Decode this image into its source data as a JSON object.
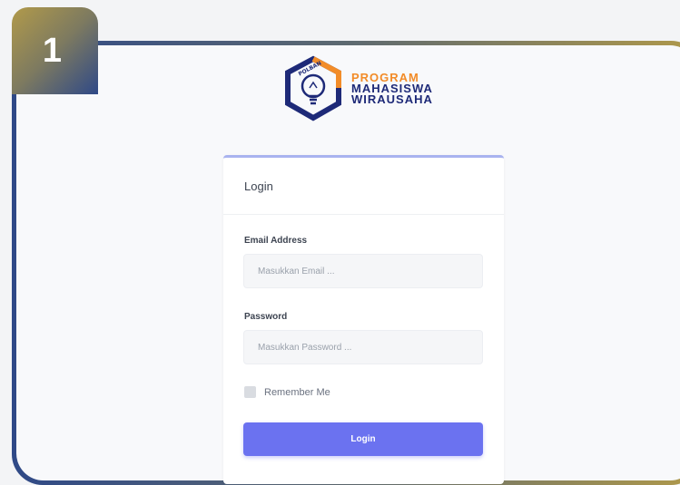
{
  "step": {
    "number": "1"
  },
  "logo": {
    "badge_text": "POLBAN",
    "line1": "PROGRAM",
    "line2": "MAHASISWA",
    "line3": "WIRAUSAHA",
    "colors": {
      "orange": "#f28c28",
      "navy": "#1e2a78"
    }
  },
  "login": {
    "title": "Login",
    "email_label": "Email Address",
    "email_placeholder": "Masukkan Email ...",
    "password_label": "Password",
    "password_placeholder": "Masukkan Password ...",
    "remember_label": "Remember Me",
    "remember_checked": false,
    "button_label": "Login",
    "accent": "#6b72f0"
  }
}
